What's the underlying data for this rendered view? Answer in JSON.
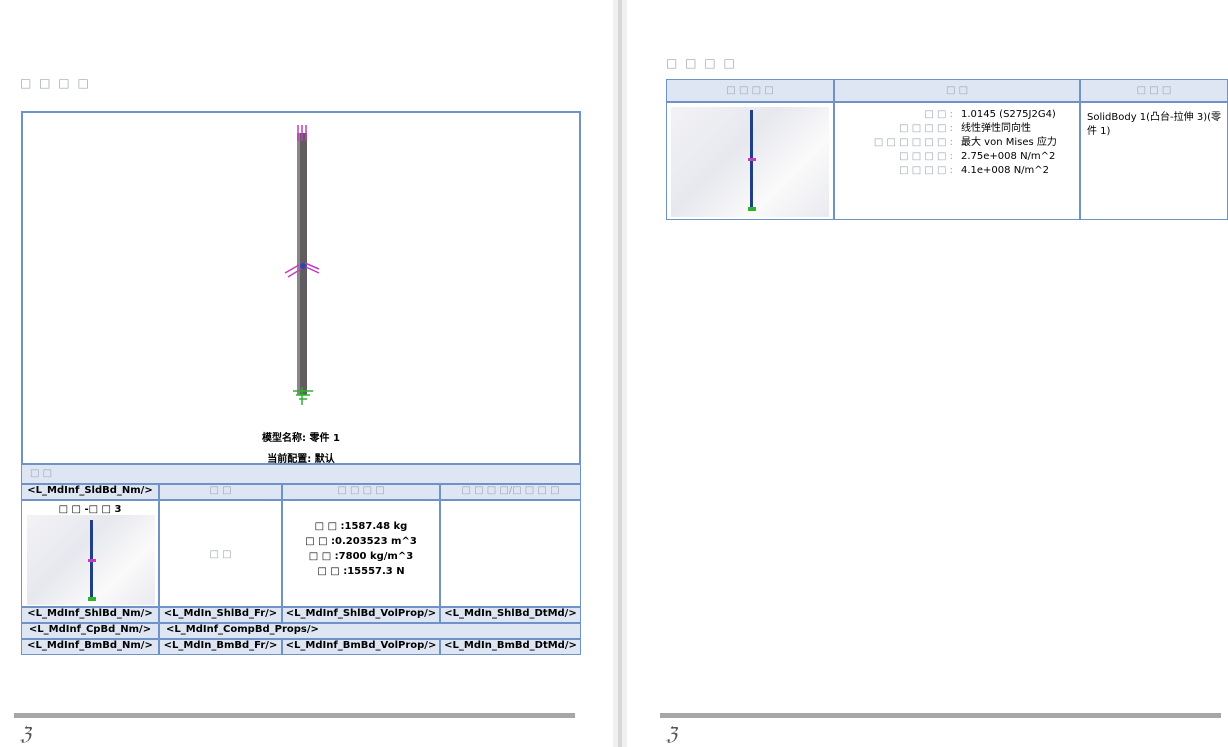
{
  "left": {
    "section_title": "□ □ □ □",
    "model_name": "模型名称: 零件 1",
    "config": "当前配置: 默认",
    "solid_header": "□ □",
    "col_headers": [
      "<L_MdInf_SldBd_Nm/>",
      "□ □",
      "□ □ □ □",
      "□ □ □ □/□ □ □ □"
    ],
    "body_name": "□ □ -□ □ 3",
    "treat_as": "□ □",
    "props": [
      "□ □ :1587.48 kg",
      "□ □ :0.203523 m^3",
      "□ □ :7800 kg/m^3",
      "□ □ :15557.3 N"
    ],
    "rows": [
      [
        "<L_MdInf_ShlBd_Nm/>",
        "<L_MdIn_ShlBd_Fr/>",
        "<L_MdInf_ShlBd_VolProp/>",
        "<L_MdIn_ShlBd_DtMd/>"
      ],
      [
        "<L_MdInf_CpBd_Nm/>",
        "<L_MdInf_CompBd_Props/>"
      ],
      [
        "<L_MdInf_BmBd_Nm/>",
        "<L_MdIn_BmBd_Fr/>",
        "<L_MdInf_BmBd_VolProp/>",
        "<L_MdIn_BmBd_DtMd/>"
      ]
    ]
  },
  "right": {
    "section_title": "□ □ □ □",
    "col_headers": [
      "□ □ □ □",
      "□ □",
      "□ □ □"
    ],
    "props": [
      {
        "label": "□ □ :",
        "value": "1.0145 (S275J2G4)"
      },
      {
        "label": "□ □ □ □ :",
        "value": "线性弹性同向性"
      },
      {
        "label": "□ □ □ □ □ □ :",
        "value": "最大 von Mises 应力"
      },
      {
        "label": "□ □ □ □ :",
        "value": "2.75e+008 N/m^2"
      },
      {
        "label": "□ □ □ □ :",
        "value": "4.1e+008 N/m^2"
      }
    ],
    "component": "SolidBody 1(凸台-拉伸 3)(零件 1)"
  },
  "logo": "ℨ"
}
